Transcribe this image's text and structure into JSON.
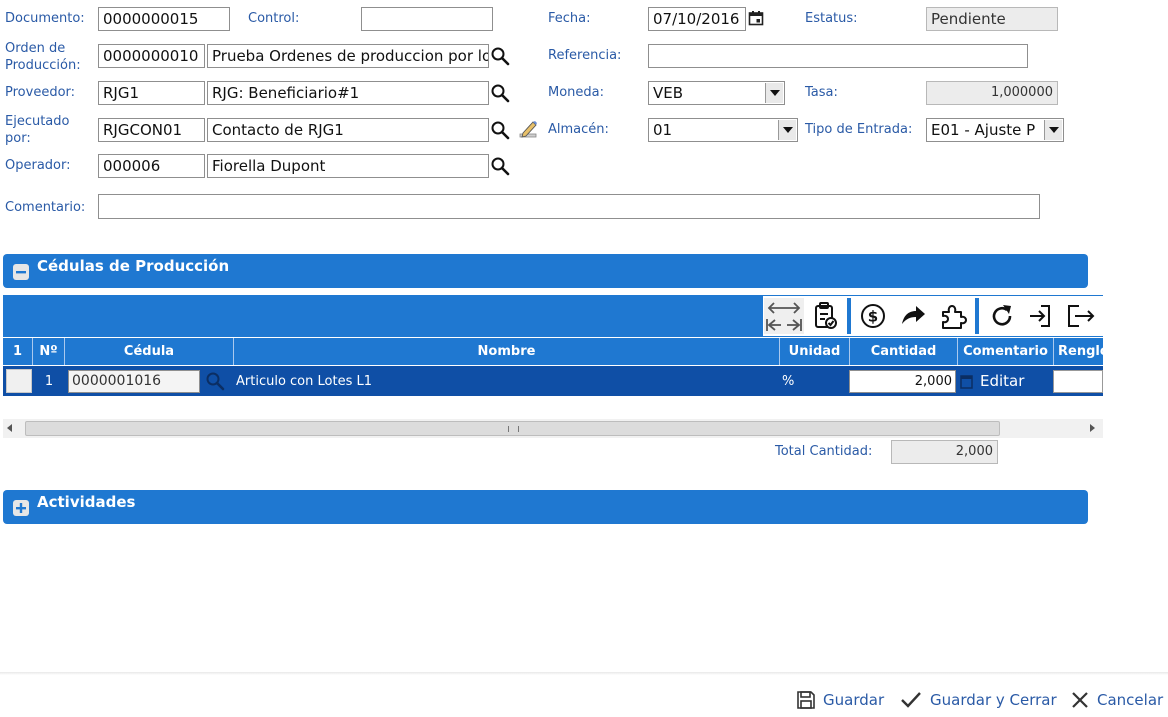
{
  "form": {
    "documento": {
      "label": "Documento:",
      "value": "0000000015"
    },
    "control": {
      "label": "Control:",
      "value": ""
    },
    "fecha": {
      "label": "Fecha:",
      "value": "07/10/2016"
    },
    "estatus": {
      "label": "Estatus:",
      "value": "Pendiente"
    },
    "orden": {
      "label_line1": "Orden de",
      "label_line2": "Producción:",
      "code": "0000000010",
      "desc": "Prueba Ordenes de produccion por lo"
    },
    "referencia": {
      "label": "Referencia:",
      "value": ""
    },
    "proveedor": {
      "label": "Proveedor:",
      "code": "RJG1",
      "desc": "RJG: Beneficiario#1"
    },
    "moneda": {
      "label": "Moneda:",
      "value": "VEB"
    },
    "tasa": {
      "label": "Tasa:",
      "value": "1,000000"
    },
    "ejecutado": {
      "label_line1": "Ejecutado",
      "label_line2": "por:",
      "code": "RJGCON01",
      "desc": "Contacto de RJG1"
    },
    "almacen": {
      "label": "Almacén:",
      "value": "01"
    },
    "tipo_entrada": {
      "label": "Tipo de Entrada:",
      "value": "E01 - Ajuste P"
    },
    "operador": {
      "label": "Operador:",
      "code": "000006",
      "desc": "Fiorella Dupont"
    },
    "comentario": {
      "label": "Comentario:",
      "value": ""
    }
  },
  "sections": {
    "cedulas": "Cédulas de Producción",
    "actividades": "Actividades"
  },
  "grid": {
    "headers": {
      "sel": "1",
      "no": "Nº",
      "cedula": "Cédula",
      "nombre": "Nombre",
      "unidad": "Unidad",
      "cantidad": "Cantidad",
      "comentario": "Comentario",
      "renglon": "Renglón"
    },
    "row": {
      "no": "1",
      "cedula": "0000001016",
      "nombre": "Articulo con Lotes L1",
      "unidad": "%",
      "cantidad": "2,000",
      "comentario": "Editar"
    },
    "total_label": "Total Cantidad:",
    "total_value": "2,000"
  },
  "footer": {
    "guardar": "Guardar",
    "guardar_cerrar": "Guardar y Cerrar",
    "cancelar": "Cancelar"
  },
  "colors": {
    "accent": "#1f78d1",
    "row_selected": "#0f4fa6",
    "label": "#2a5aa6"
  },
  "icons": [
    "search-icon",
    "calendar-icon",
    "edit-pencil-icon",
    "expand-columns-icon",
    "clipboard-check-icon",
    "dollar-icon",
    "forward-arrow-icon",
    "puzzle-icon",
    "refresh-icon",
    "import-icon",
    "export-icon",
    "save-icon",
    "check-icon",
    "close-icon",
    "collapse-icon",
    "expand-icon"
  ]
}
